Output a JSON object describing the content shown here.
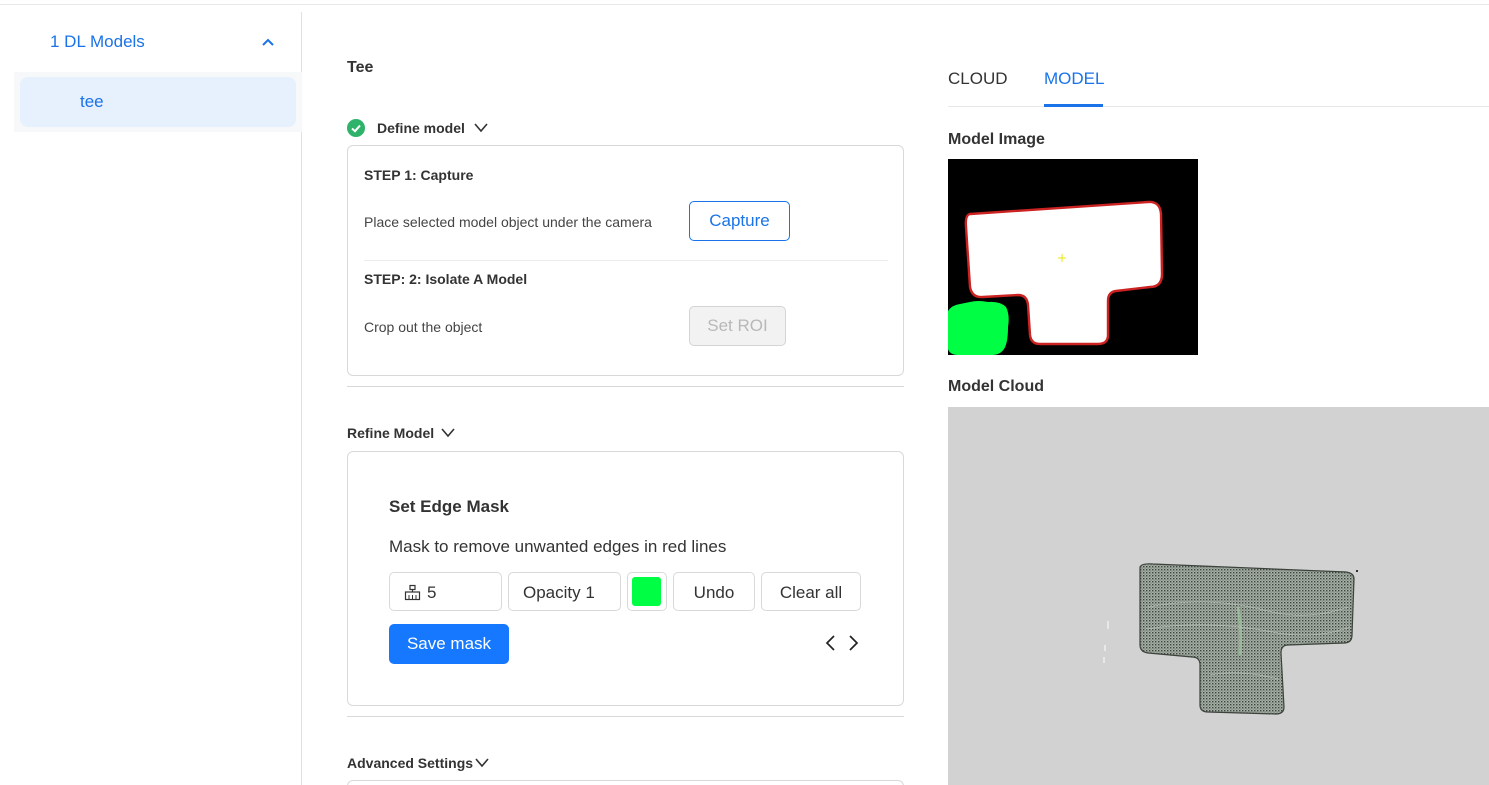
{
  "sidebar": {
    "group_label": "1 DL Models",
    "items": [
      {
        "label": "tee"
      }
    ]
  },
  "page": {
    "title": "Tee"
  },
  "define_model": {
    "label": "Define model",
    "step1": {
      "title": "STEP 1: Capture",
      "description": "Place selected model object under the camera",
      "button": "Capture"
    },
    "step2": {
      "title": "STEP: 2: Isolate A Model",
      "description": "Crop out the object",
      "button": "Set ROI"
    }
  },
  "refine_model": {
    "label": "Refine Model",
    "mask_title": "Set Edge Mask",
    "mask_description": "Mask to remove unwanted edges in red lines",
    "brush_size": "5",
    "opacity": "Opacity 1",
    "mask_color": "#00ff44",
    "undo": "Undo",
    "clear_all": "Clear all",
    "save_mask": "Save mask"
  },
  "advanced_settings": {
    "label": "Advanced Settings"
  },
  "viewer": {
    "tabs": [
      {
        "label": "CLOUD",
        "active": false
      },
      {
        "label": "MODEL",
        "active": true
      }
    ],
    "model_image_label": "Model Image",
    "model_cloud_label": "Model Cloud"
  },
  "colors": {
    "accent": "#1a73e8",
    "primary_button": "#1677ff",
    "success": "#2fb36a"
  }
}
